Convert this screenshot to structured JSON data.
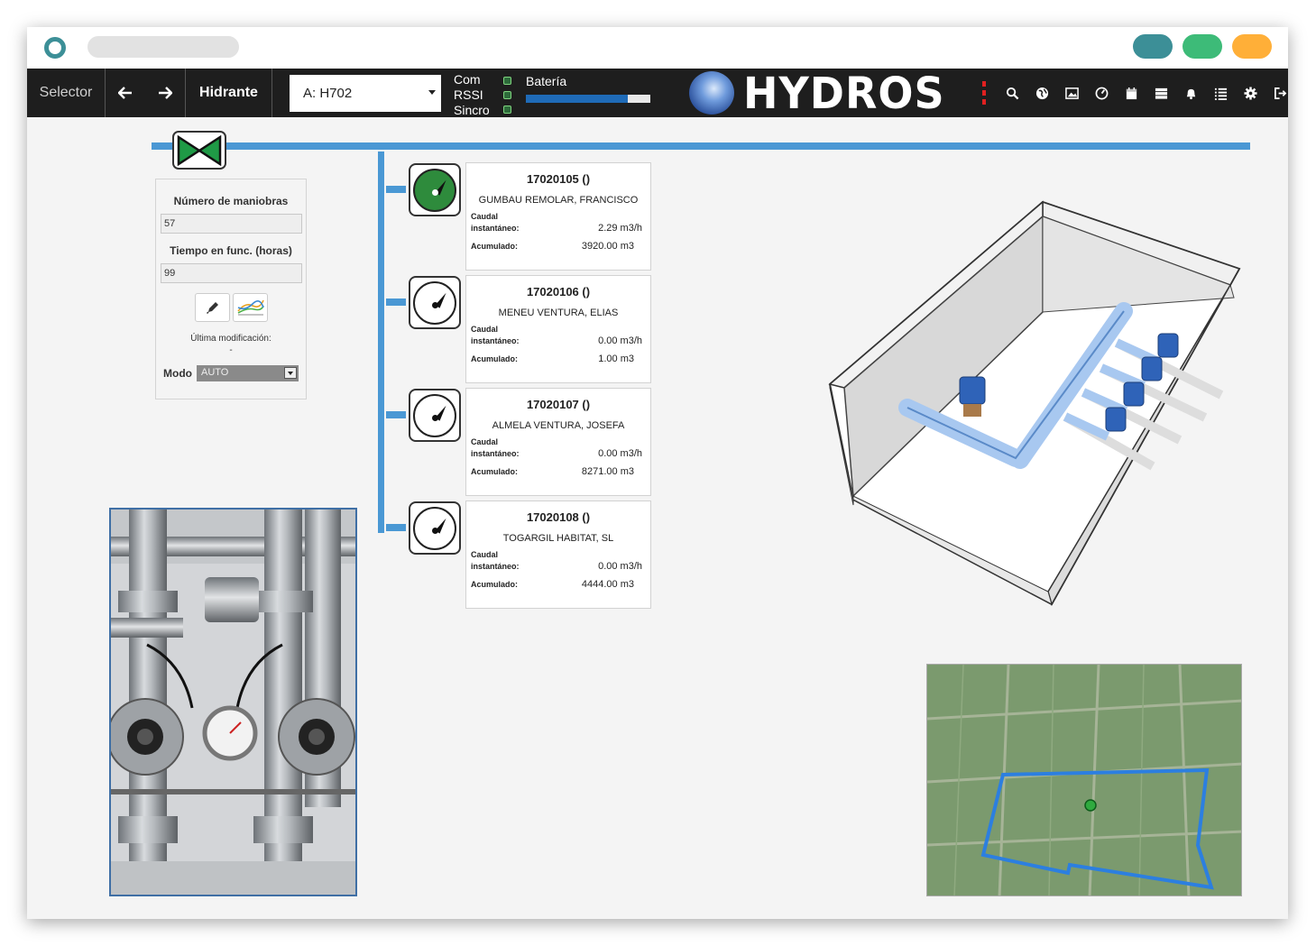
{
  "nav": {
    "selector_label": "Selector",
    "back_icon": "arrow-left-icon",
    "forward_icon": "arrow-right-icon",
    "section_label": "Hidrante",
    "selected_value": "A: H702",
    "status": {
      "com_label": "Com",
      "rssi_label": "RSSI",
      "sincro_label": "Sincro"
    },
    "battery_label": "Batería",
    "battery_level": 0.82,
    "brand_name": "HYDROS",
    "tools": [
      "search-icon",
      "globe-icon",
      "image-icon",
      "gauge-icon",
      "calendar-icon",
      "server-icon",
      "bell-icon",
      "list-icon",
      "gear-icon",
      "logout-icon"
    ]
  },
  "colors": {
    "accent_bus": "#4a98d4",
    "active_green": "#2e8b3c",
    "navbar": "#1e1e1e",
    "window_dots": [
      "#3c8f97",
      "#3dbb78",
      "#ffaf38"
    ]
  },
  "panel": {
    "maneuvers_label": "Número de maniobras",
    "maneuvers_value": "57",
    "hours_label": "Tiempo en func. (horas)",
    "hours_value": "99",
    "last_mod_label": "Última modificación:",
    "last_mod_value": "-",
    "mode_label": "Modo",
    "mode_value": "AUTO"
  },
  "meters": [
    {
      "id": "17020105 ()",
      "owner": "GUMBAU REMOLAR, FRANCISCO",
      "flow_label_1": "Caudal",
      "flow_label_2": "instantáneo:",
      "flow_value": "2.29 m3/h",
      "acc_label": "Acumulado:",
      "acc_value": "3920.00 m3",
      "active": true
    },
    {
      "id": "17020106 ()",
      "owner": "MENEU VENTURA, ELIAS",
      "flow_label_1": "Caudal",
      "flow_label_2": "instantáneo:",
      "flow_value": "0.00 m3/h",
      "acc_label": "Acumulado:",
      "acc_value": "1.00 m3",
      "active": false
    },
    {
      "id": "17020107 ()",
      "owner": "ALMELA VENTURA, JOSEFA",
      "flow_label_1": "Caudal",
      "flow_label_2": "instantáneo:",
      "flow_value": "0.00 m3/h",
      "acc_label": "Acumulado:",
      "acc_value": "8271.00 m3",
      "active": false
    },
    {
      "id": "17020108 ()",
      "owner": "TOGARGIL HABITAT, SL",
      "flow_label_1": "Caudal",
      "flow_label_2": "instantáneo:",
      "flow_value": "0.00 m3/h",
      "acc_label": "Acumulado:",
      "acc_value": "4444.00 m3",
      "active": false
    }
  ]
}
